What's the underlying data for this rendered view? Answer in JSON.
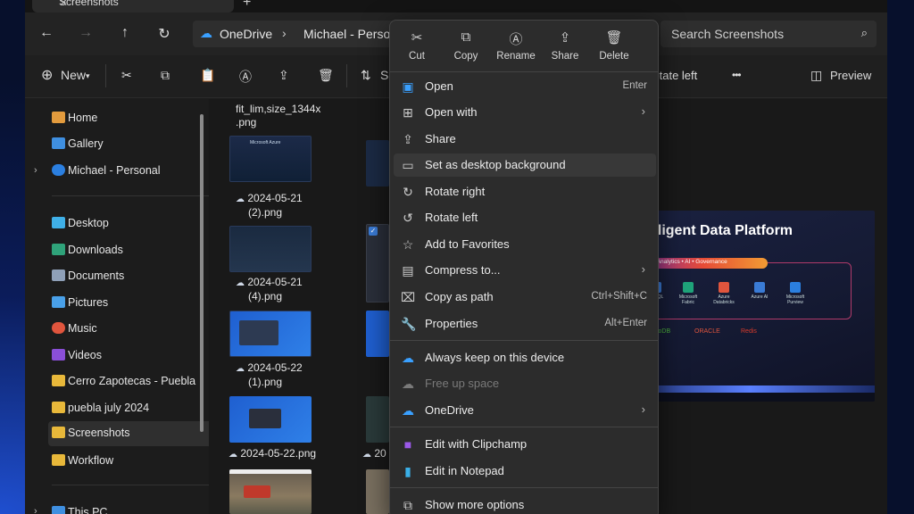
{
  "tab": {
    "title": "Screenshots",
    "close": "✕",
    "new": "+"
  },
  "address": {
    "root": "OneDrive",
    "sep": "›",
    "current": "Michael - Person"
  },
  "search": {
    "placeholder": "Search Screenshots",
    "icon": "⌕"
  },
  "toolbar": {
    "new_label": "New",
    "sort_label": "S",
    "rotate_left": "Rotate left",
    "more": "•••",
    "preview": "Preview"
  },
  "sidebar": {
    "items": [
      {
        "label": "Home"
      },
      {
        "label": "Gallery"
      },
      {
        "label": "Michael - Personal"
      },
      {
        "label": "Desktop"
      },
      {
        "label": "Downloads"
      },
      {
        "label": "Documents"
      },
      {
        "label": "Pictures"
      },
      {
        "label": "Music"
      },
      {
        "label": "Videos"
      },
      {
        "label": "Cerro Zapotecas - Puebla"
      },
      {
        "label": "puebla july 2024"
      },
      {
        "label": "Screenshots"
      },
      {
        "label": "Workflow"
      },
      {
        "label": "This PC"
      }
    ]
  },
  "files": {
    "top_name_1": "fit_lim,size_1344x",
    "top_name_2": ".png",
    "f1_a": "2024-05-21",
    "f1_b": "(2).png",
    "f2_a": "2024-05-21",
    "f2_b": "(4).png",
    "f3_a": "2024-05-22",
    "f3_b": "(1).png",
    "f4": "2024-05-22.png",
    "thumb_title": "Microsoft Azure"
  },
  "preview": {
    "title": "Intelligent Data Platform",
    "pill": "• Analytics • AI • Governance",
    "services": [
      "MySQL",
      "Microsoft Fabric",
      "Azure Databricks",
      "Azure AI",
      "Microsoft Purview"
    ],
    "logos": [
      "MongoDB",
      "ORACLE",
      "Redis"
    ]
  },
  "context_menu": {
    "quick_actions": [
      {
        "label": "Cut",
        "icon": "✂"
      },
      {
        "label": "Copy",
        "icon": "⧉"
      },
      {
        "label": "Rename",
        "icon": "Ⓐ"
      },
      {
        "label": "Share",
        "icon": "⇪"
      },
      {
        "label": "Delete",
        "icon": "🗑"
      }
    ],
    "items": [
      {
        "label": "Open",
        "shortcut": "Enter"
      },
      {
        "label": "Open with",
        "arrow": "›"
      },
      {
        "label": "Share"
      },
      {
        "label": "Set as desktop background"
      },
      {
        "label": "Rotate right"
      },
      {
        "label": "Rotate left"
      },
      {
        "label": "Add to Favorites"
      },
      {
        "label": "Compress to...",
        "arrow": "›"
      },
      {
        "label": "Copy as path",
        "shortcut": "Ctrl+Shift+C"
      },
      {
        "label": "Properties",
        "shortcut": "Alt+Enter"
      },
      {
        "label": "Always keep on this device"
      },
      {
        "label": "Free up space"
      },
      {
        "label": "OneDrive",
        "arrow": "›"
      },
      {
        "label": "Edit with Clipchamp"
      },
      {
        "label": "Edit in Notepad"
      },
      {
        "label": "Show more options"
      }
    ]
  },
  "colors": {
    "accent": "#3aa0ff",
    "menu_bg": "#2c2c2c",
    "folder": "#e8b83a"
  }
}
